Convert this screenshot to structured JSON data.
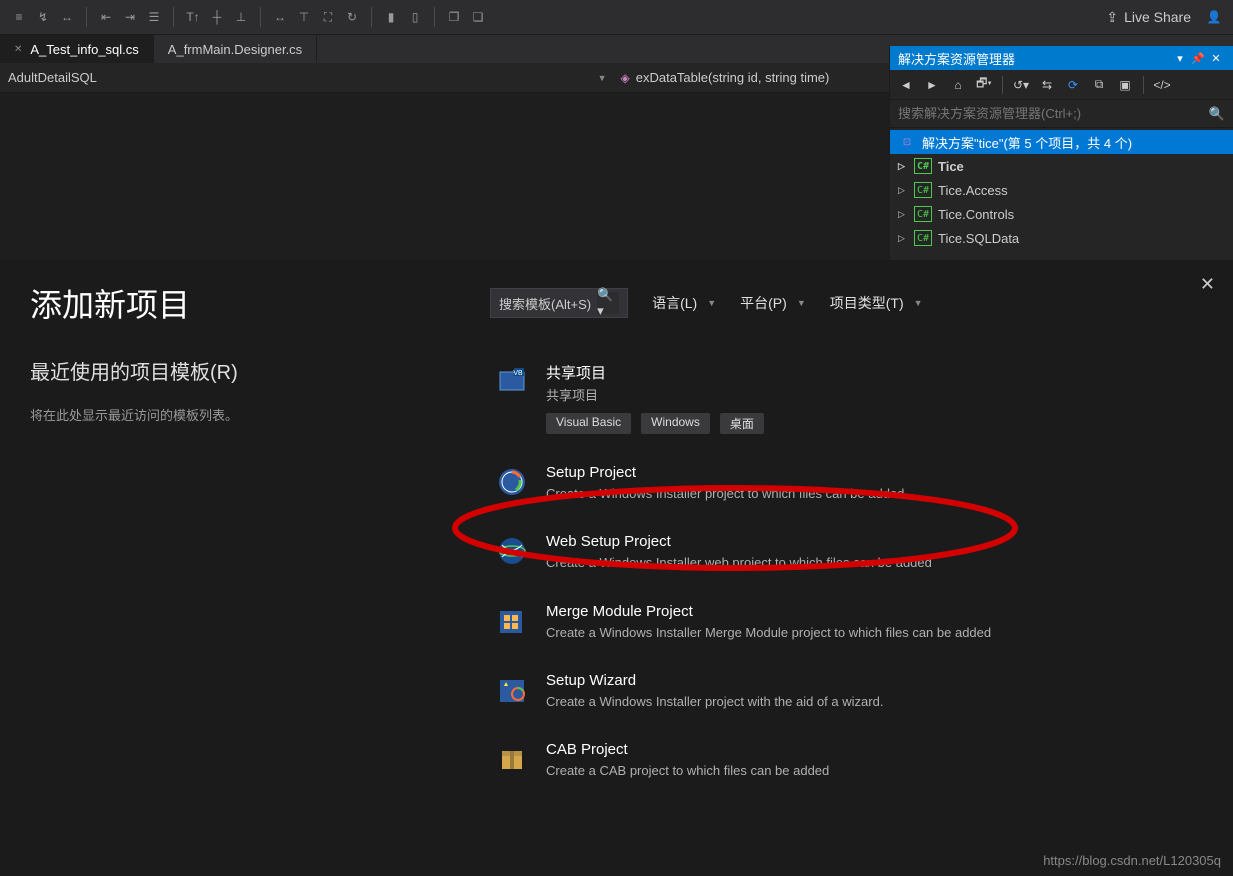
{
  "toolbar": {
    "live_share": "Live Share"
  },
  "tabs": {
    "items": [
      {
        "label": "A_Test_info_sql.cs",
        "active": true
      },
      {
        "label": "A_frmMain.Designer.cs",
        "active": false
      }
    ]
  },
  "navbar": {
    "left": "AdultDetailSQL",
    "right": "exDataTable(string id, string time)"
  },
  "solution": {
    "title": "解决方案资源管理器",
    "search_placeholder": "搜索解决方案资源管理器(Ctrl+;)",
    "root": "解决方案\"tice\"(第 5 个项目，共 4 个)",
    "projects": [
      {
        "name": "Tice",
        "bold": true
      },
      {
        "name": "Tice.Access",
        "bold": false
      },
      {
        "name": "Tice.Controls",
        "bold": false
      },
      {
        "name": "Tice.SQLData",
        "bold": false
      }
    ]
  },
  "dialog": {
    "title": "添加新项目",
    "search_placeholder": "搜索模板(Alt+S)",
    "filters": [
      {
        "label": "语言(L)"
      },
      {
        "label": "平台(P)"
      },
      {
        "label": "项目类型(T)"
      }
    ],
    "recent_title": "最近使用的项目模板(R)",
    "recent_empty": "将在此处显示最近访问的模板列表。",
    "templates": [
      {
        "title": "共享项目",
        "desc": "共享项目",
        "tags": [
          "Visual Basic",
          "Windows",
          "桌面"
        ],
        "icon": "shared"
      },
      {
        "title": "Setup Project",
        "desc": "Create a Windows Installer project to which files can be added",
        "tags": [],
        "icon": "setup",
        "highlighted": true
      },
      {
        "title": "Web Setup Project",
        "desc": "Create a Windows Installer web project to which files can be added",
        "tags": [],
        "icon": "web"
      },
      {
        "title": "Merge Module Project",
        "desc": "Create a Windows Installer Merge Module project to which files can be added",
        "tags": [],
        "icon": "merge"
      },
      {
        "title": "Setup Wizard",
        "desc": "Create a Windows Installer project with the aid of a wizard.",
        "tags": [],
        "icon": "wizard"
      },
      {
        "title": "CAB Project",
        "desc": "Create a CAB project to which files can be added",
        "tags": [],
        "icon": "cab"
      }
    ]
  },
  "watermark": "https://blog.csdn.net/L120305q"
}
